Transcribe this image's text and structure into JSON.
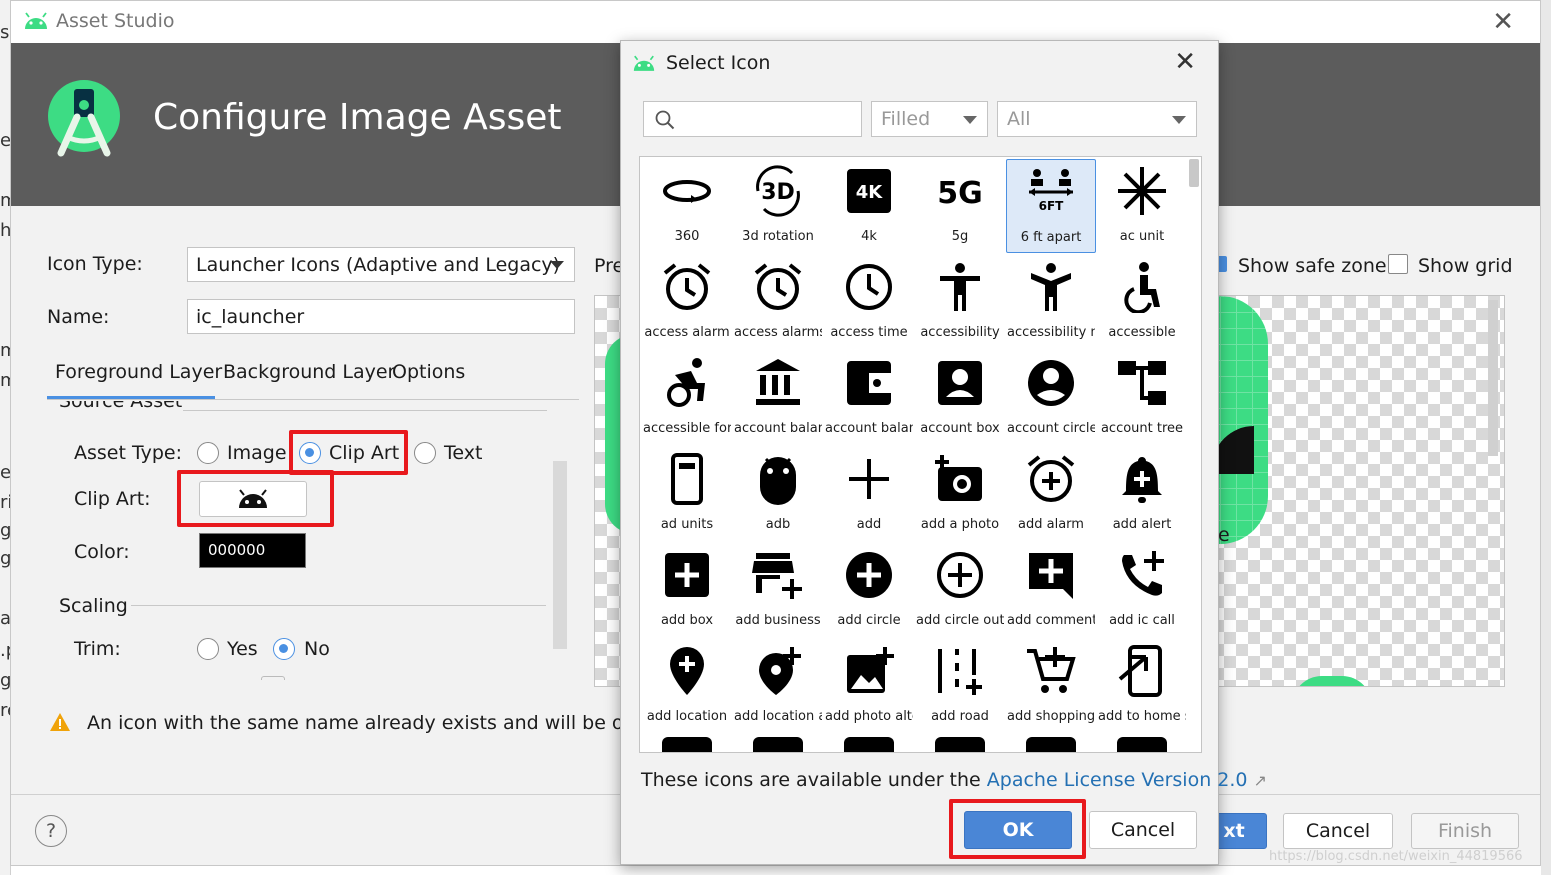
{
  "window": {
    "title": "Asset Studio",
    "close_glyph": "✕"
  },
  "banner": {
    "heading": "Configure Image Asset",
    "logo": "android-studio-logo"
  },
  "form": {
    "icon_type_label": "Icon Type:",
    "icon_type_value": "Launcher Icons (Adaptive and Legacy)",
    "name_label": "Name:",
    "name_value": "ic_launcher",
    "tabs": [
      "Foreground Layer",
      "Background Layer",
      "Options"
    ],
    "source_asset_label": "Source Asset",
    "asset_type_label": "Asset Type:",
    "asset_types": [
      {
        "label": "Image",
        "selected": false
      },
      {
        "label": "Clip Art",
        "selected": true
      },
      {
        "label": "Text",
        "selected": false
      }
    ],
    "clip_art_label": "Clip Art:",
    "clip_art_icon": "android-icon",
    "color_label": "Color:",
    "color_value": "000000",
    "scaling_label": "Scaling",
    "trim_label": "Trim:",
    "trim_options": [
      {
        "label": "Yes",
        "selected": false
      },
      {
        "label": "No",
        "selected": true
      }
    ],
    "warning": "An icon with the same name already exists and will be overwrit"
  },
  "preview": {
    "label": "Pre",
    "show_safe_zone": {
      "label": "Show safe zone",
      "checked": true
    },
    "show_grid": {
      "label": "Show grid",
      "checked": false
    },
    "partial_text": "e"
  },
  "footer": {
    "help_glyph": "?",
    "next_partial": "xt",
    "cancel": "Cancel",
    "finish": "Finish",
    "watermark": "https://blog.csdn.net/weixin_44819566"
  },
  "dialog": {
    "title": "Select Icon",
    "close_glyph": "✕",
    "search_value": "",
    "style_filter": "Filled",
    "category_filter": "All",
    "icons": [
      {
        "name": "360",
        "icon": "360-icon"
      },
      {
        "name": "3d rotation",
        "icon": "3d-rotation-icon"
      },
      {
        "name": "4k",
        "icon": "4k-icon"
      },
      {
        "name": "5g",
        "icon": "5g-icon"
      },
      {
        "name": "6 ft apart",
        "icon": "6-ft-apart-icon",
        "selected": true
      },
      {
        "name": "ac unit",
        "icon": "ac-unit-icon"
      },
      {
        "name": "access alarm",
        "icon": "alarm-icon"
      },
      {
        "name": "access alarms",
        "icon": "alarm-icon"
      },
      {
        "name": "access time",
        "icon": "clock-icon"
      },
      {
        "name": "accessibility",
        "icon": "accessibility-icon"
      },
      {
        "name": "accessibility new",
        "icon": "accessibility-new-icon"
      },
      {
        "name": "accessible",
        "icon": "accessible-icon"
      },
      {
        "name": "accessible forward",
        "icon": "accessible-forward-icon"
      },
      {
        "name": "account balance",
        "icon": "account-balance-icon"
      },
      {
        "name": "account balance wallet",
        "icon": "wallet-icon"
      },
      {
        "name": "account box",
        "icon": "account-box-icon"
      },
      {
        "name": "account circle",
        "icon": "account-circle-icon"
      },
      {
        "name": "account tree",
        "icon": "account-tree-icon"
      },
      {
        "name": "ad units",
        "icon": "ad-units-icon"
      },
      {
        "name": "adb",
        "icon": "adb-icon"
      },
      {
        "name": "add",
        "icon": "add-icon"
      },
      {
        "name": "add a photo",
        "icon": "add-a-photo-icon"
      },
      {
        "name": "add alarm",
        "icon": "add-alarm-icon"
      },
      {
        "name": "add alert",
        "icon": "add-alert-icon"
      },
      {
        "name": "add box",
        "icon": "add-box-icon"
      },
      {
        "name": "add business",
        "icon": "add-business-icon"
      },
      {
        "name": "add circle",
        "icon": "add-circle-icon"
      },
      {
        "name": "add circle outline",
        "icon": "add-circle-outline-icon"
      },
      {
        "name": "add comment",
        "icon": "add-comment-icon"
      },
      {
        "name": "add ic call",
        "icon": "add-ic-call-icon"
      },
      {
        "name": "add location",
        "icon": "add-location-icon"
      },
      {
        "name": "add location alt",
        "icon": "add-location-alt-icon"
      },
      {
        "name": "add photo alternate",
        "icon": "add-photo-icon"
      },
      {
        "name": "add road",
        "icon": "add-road-icon"
      },
      {
        "name": "add shopping cart",
        "icon": "add-shopping-cart-icon"
      },
      {
        "name": "add to home screen",
        "icon": "add-to-home-screen-icon"
      }
    ],
    "license_prefix": "These icons are available under the ",
    "license_link": "Apache License Version 2.0",
    "license_link_glyph": "↗",
    "ok": "OK",
    "cancel": "Cancel"
  },
  "colors": {
    "highlight_red": "#e8191d",
    "ok_blue": "#4a86d6",
    "android_green": "#3ddc84",
    "banner_gray": "#5c5c5c",
    "link_blue": "#2470b3"
  }
}
